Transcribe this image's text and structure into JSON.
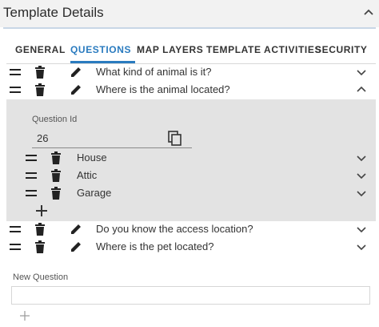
{
  "panel": {
    "title": "Template Details"
  },
  "tabs": [
    {
      "label": "GENERAL"
    },
    {
      "label": "QUESTIONS",
      "active": true
    },
    {
      "label": "MAP LAYERS"
    },
    {
      "label": "TEMPLATE ACTIVITIES"
    },
    {
      "label": "SECURITY"
    }
  ],
  "questions": [
    {
      "text": "What kind of animal is it?",
      "expanded": false
    },
    {
      "text": "Where is the animal located?",
      "expanded": true
    },
    {
      "text": "Do you know the access location?",
      "expanded": false
    },
    {
      "text": "Where is the pet located?",
      "expanded": false
    }
  ],
  "expanded_question": {
    "id_label": "Question Id",
    "id_value": "26",
    "answers": [
      {
        "text": "House"
      },
      {
        "text": "Attic"
      },
      {
        "text": "Garage"
      }
    ]
  },
  "new_question": {
    "label": "New Question",
    "value": ""
  },
  "colors": {
    "accent": "#2a7bbf",
    "expanded_bg": "#e3e3e3",
    "header_bg": "#f2f2f2"
  },
  "icons": [
    "chevron-up-icon",
    "drag-handle-icon",
    "trash-icon",
    "pencil-icon",
    "chevron-down-icon",
    "copy-icon",
    "plus-icon"
  ]
}
